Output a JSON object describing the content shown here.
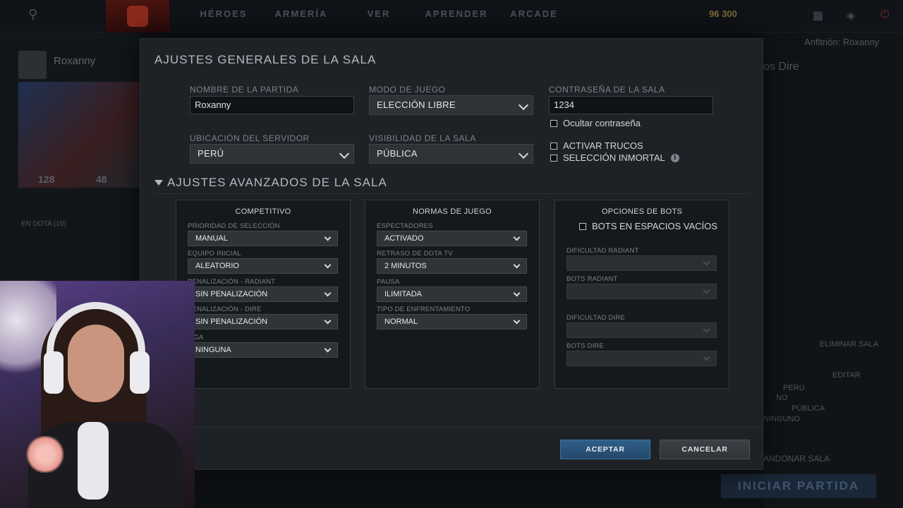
{
  "topbar": {
    "nav": [
      "HÉROES",
      "ARMERÍA",
      "VER",
      "APRENDER",
      "ARCADE"
    ],
    "coins": "96  300"
  },
  "left_panel": {
    "player_name": "Roxanny",
    "stat1": "128",
    "stat2": "48",
    "friends_label": "EN DOTA (10)"
  },
  "right_panel": {
    "host": "Anfitrión: Roxanny",
    "team_dire": "os Dire",
    "server": "PERÚ",
    "cheats": "NO",
    "visibility": "PÚBLICA",
    "league": "NINGUNO",
    "delete_lobby": "ELIMINAR SALA",
    "edit": "EDITAR",
    "leave": "ANDONAR SALA",
    "start_button": "INICIAR PARTIDA"
  },
  "modal": {
    "title": "AJUSTES GENERALES DE LA SALA",
    "game_name_label": "NOMBRE DE LA PARTIDA",
    "game_name_value": "Roxanny",
    "game_mode_label": "MODO DE JUEGO",
    "game_mode_value": "ELECCIÓN LIBRE",
    "password_label": "CONTRASEÑA DE LA SALA",
    "password_value": "1234",
    "hide_password": "Ocultar contraseña",
    "server_label": "UBICACIÓN DEL SERVIDOR",
    "server_value": "PERÚ",
    "visibility_label": "VISIBILIDAD DE LA SALA",
    "visibility_value": "PÚBLICA",
    "enable_cheats": "ACTIVAR TRUCOS",
    "immortal_pick": "SELECCIÓN INMORTAL",
    "advanced_title": "AJUSTES AVANZADOS DE LA SALA",
    "accept": "ACEPTAR",
    "cancel": "CANCELAR"
  },
  "panels": {
    "competitive": {
      "title": "COMPETITIVO",
      "fields": [
        {
          "label": "PRIORIDAD DE SELECCIÓN",
          "value": "MANUAL"
        },
        {
          "label": "EQUIPO INICIAL",
          "value": "ALEATORIO"
        },
        {
          "label": "PENALIZACIÓN - RADIANT",
          "value": "SIN PENALIZACIÓN"
        },
        {
          "label": "PENALIZACIÓN - DIRE",
          "value": "SIN PENALIZACIÓN"
        },
        {
          "label": "LIGA",
          "value": "NINGUNA"
        }
      ]
    },
    "rules": {
      "title": "NORMAS DE JUEGO",
      "fields": [
        {
          "label": "ESPECTADORES",
          "value": "ACTIVADO"
        },
        {
          "label": "RETRASO DE DOTA TV",
          "value": "2 MINUTOS"
        },
        {
          "label": "PAUSA",
          "value": "ILIMITADA"
        },
        {
          "label": "TIPO DE ENFRENTAMIENTO",
          "value": "NORMAL"
        }
      ]
    },
    "bots": {
      "title": "OPCIONES DE BOTS",
      "fill_bots": "BOTS EN ESPACIOS VACÍOS",
      "fields": [
        {
          "label": "DIFICULTAD RADIANT"
        },
        {
          "label": "BOTS RADIANT"
        },
        {
          "label": "DIFICULTAD DIRE"
        },
        {
          "label": "BOTS DIRE"
        }
      ]
    }
  }
}
